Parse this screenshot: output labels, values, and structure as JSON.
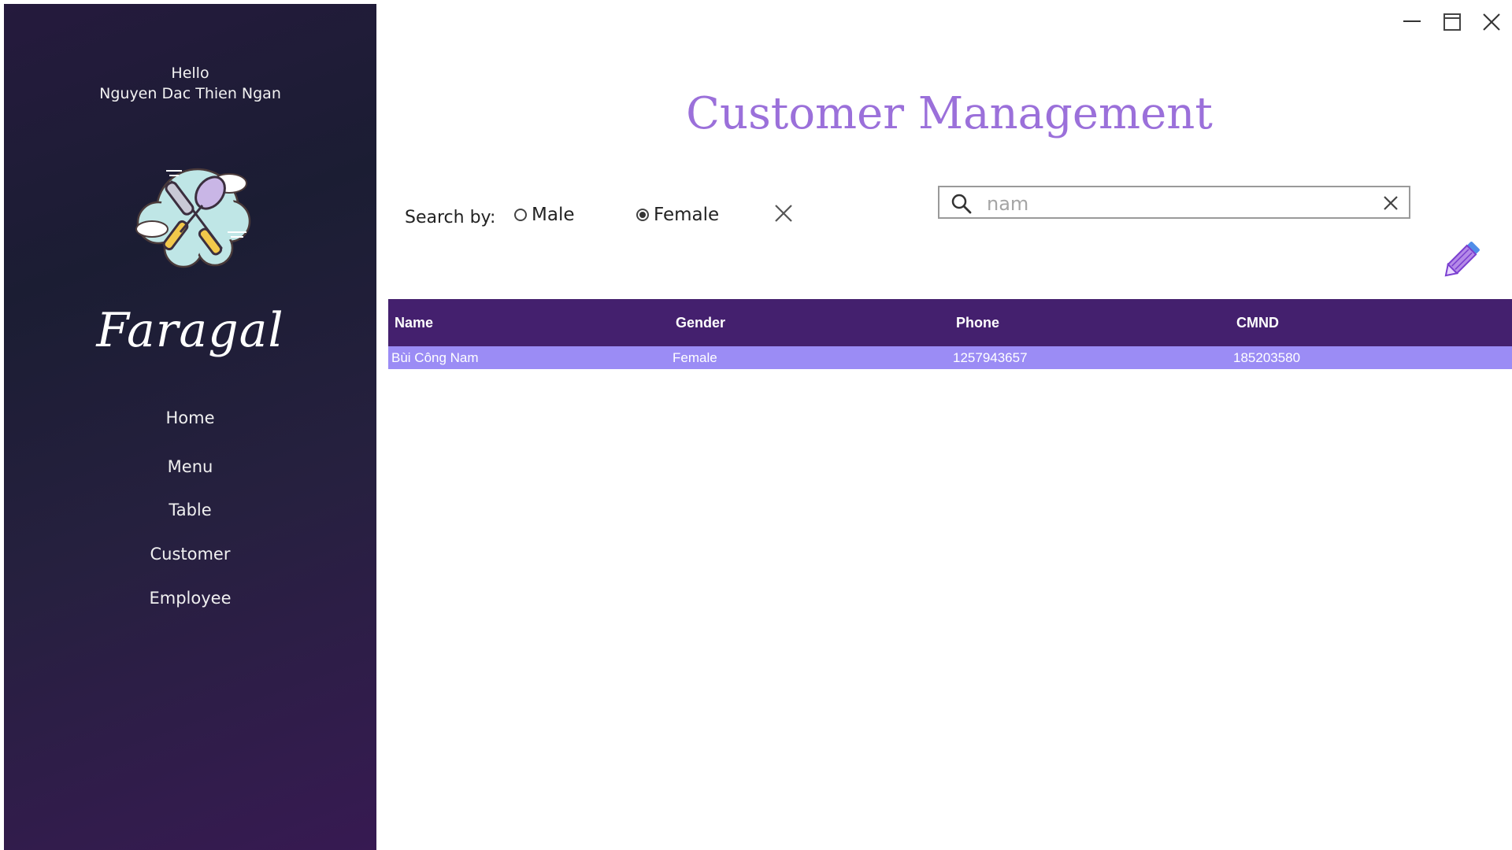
{
  "sidebar": {
    "greeting": "Hello",
    "user_name": "Nguyen Dac Thien Ngan",
    "logo_icon": "fork-spoon-cloud-logo",
    "brand": "Faragal",
    "nav": [
      "Home",
      "Menu",
      "Table",
      "Customer",
      "Employee"
    ]
  },
  "window_controls": {
    "minimize_icon": "minimize-icon",
    "maximize_icon": "maximize-icon",
    "close_icon": "close-icon"
  },
  "main": {
    "title": "Customer Management",
    "search_by_label": "Search by:",
    "filter_options": [
      {
        "label": "Male",
        "selected": false
      },
      {
        "label": "Female",
        "selected": true
      }
    ],
    "search": {
      "value": "nam",
      "placeholder": ""
    },
    "edit_icon": "pencil-icon"
  },
  "table": {
    "columns": [
      "Name",
      "Gender",
      "Phone",
      "CMND"
    ],
    "rows": [
      {
        "name": "Bùi Công Nam",
        "gender": "Female",
        "phone": "1257943657",
        "cmnd": "185203580",
        "selected": true
      }
    ]
  },
  "colors": {
    "accent": "#9b70da",
    "table_header": "#44206e",
    "selected_row": "#9b8cf5",
    "sidebar_dark": "#1b1d33",
    "sidebar_purple": "#371a52"
  }
}
